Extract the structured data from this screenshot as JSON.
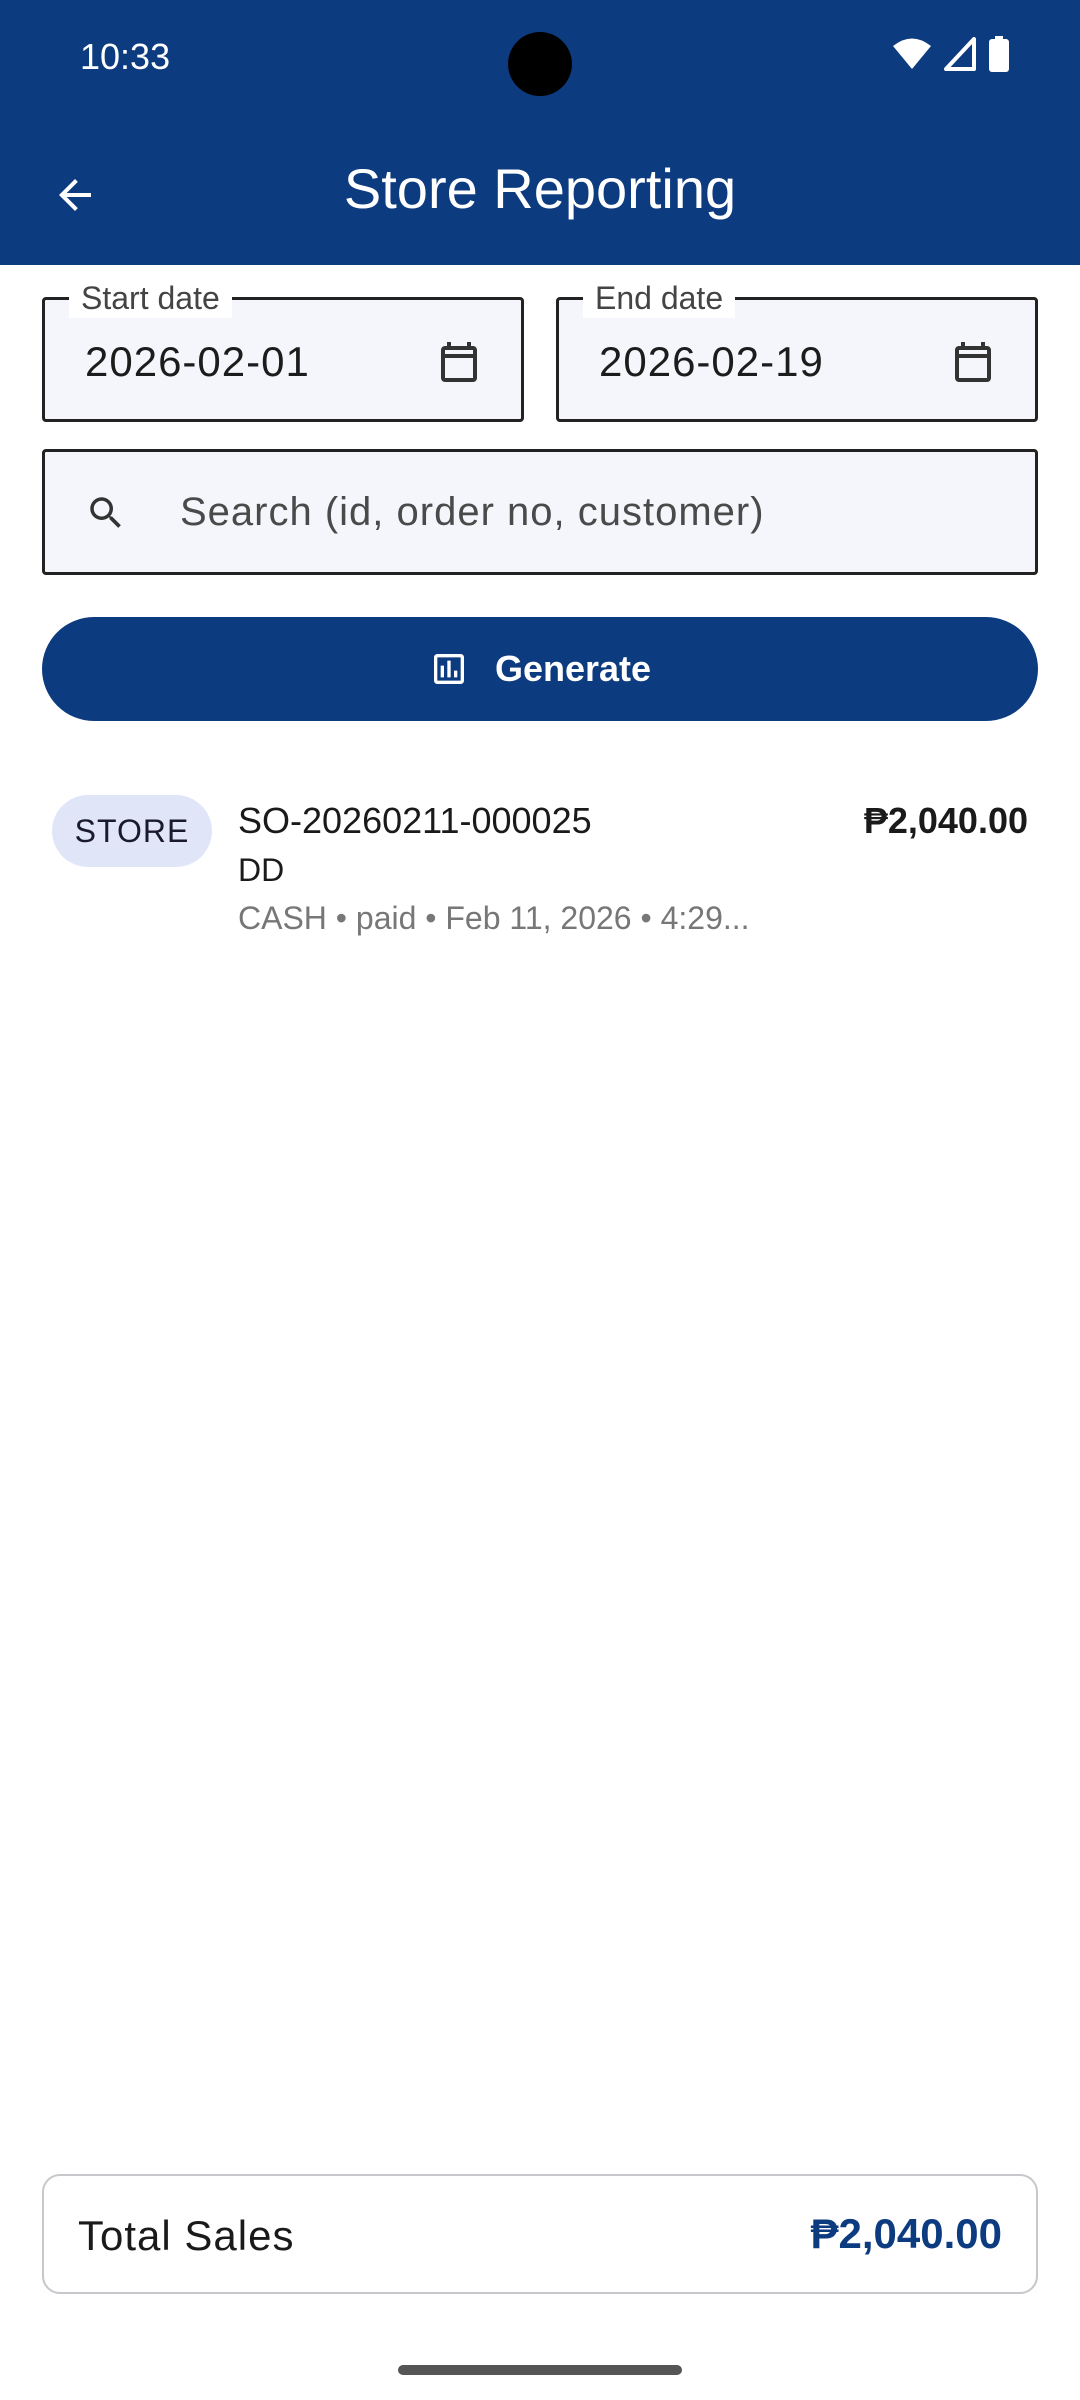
{
  "status_bar": {
    "time": "10:33"
  },
  "app_bar": {
    "title": "Store Reporting"
  },
  "filters": {
    "start_date": {
      "label": "Start date",
      "value": "2026-02-01"
    },
    "end_date": {
      "label": "End date",
      "value": "2026-02-19"
    },
    "search": {
      "placeholder": "Search (id, order no, customer)",
      "value": ""
    },
    "generate_label": "Generate"
  },
  "orders": [
    {
      "badge": "STORE",
      "order_no": "SO-20260211-000025",
      "customer": "DD",
      "meta": "CASH • paid • Feb 11, 2026 • 4:29...",
      "amount": "₱2,040.00"
    }
  ],
  "footer": {
    "total_label": "Total Sales",
    "total_value": "₱2,040.00"
  },
  "colors": {
    "primary": "#0d3b80",
    "badge_bg": "#e0e5f8",
    "field_bg": "#f4f6fb"
  },
  "icons": [
    "back-arrow-icon",
    "calendar-icon",
    "search-icon",
    "bar-chart-icon",
    "wifi-icon",
    "signal-icon",
    "battery-icon"
  ]
}
